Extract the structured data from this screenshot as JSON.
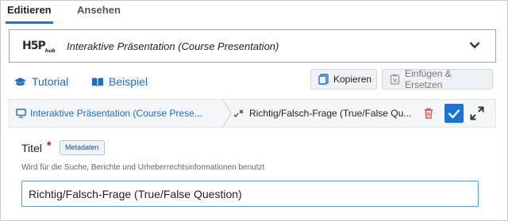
{
  "tabs": {
    "edit": "Editieren",
    "view": "Ansehen"
  },
  "selector": {
    "logo": "H5P",
    "logo_sub": "hub",
    "title": "Interaktive Präsentation (Course Presentation)"
  },
  "help": {
    "tutorial": "Tutorial",
    "example": "Beispiel"
  },
  "clipboard": {
    "copy": "Kopieren",
    "paste": "Einfügen & Ersetzen"
  },
  "breadcrumb": {
    "parent": "Interaktive Präsentation (Course Prese...",
    "current": "Richtig/Falsch-Frage (True/False Qu..."
  },
  "form": {
    "label": "Titel",
    "required_mark": "*",
    "metadata_button": "Metadaten",
    "description": "Wird für die Suche, Berichte und Urheberrechtsinformationen benutzt",
    "value": "Richtig/Falsch-Frage (True/False Question)"
  },
  "colors": {
    "accent": "#1a73d9",
    "link": "#1a6fc9",
    "required": "#d0021b",
    "delete": "#e0504a"
  }
}
